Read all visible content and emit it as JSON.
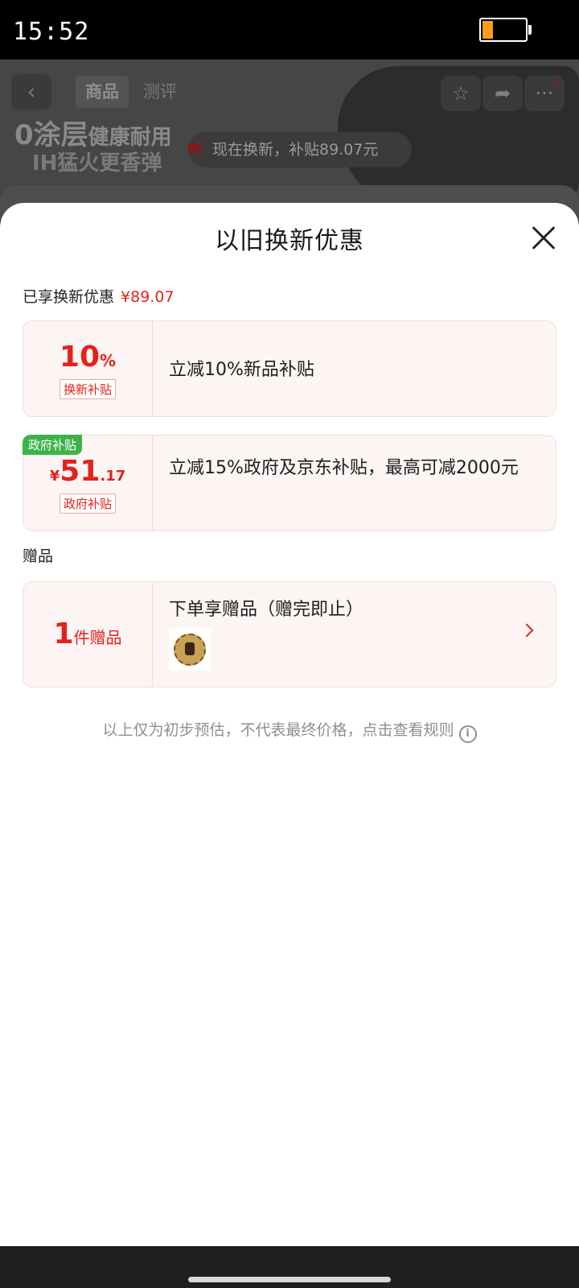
{
  "status_bar": {
    "time": "15:52",
    "battery_level": 0.25,
    "battery_color": "#ff9a1a"
  },
  "background_page": {
    "tabs": [
      "商品",
      "测评"
    ],
    "cart_badge": "2",
    "promo_line1_big": "0涂层",
    "promo_line1_small": "健康耐用",
    "promo_line2": "IH猛火更香弹",
    "banner_text": "现在换新，补贴89.07元",
    "icons": [
      "back-icon",
      "star-icon",
      "share-icon",
      "more-icon"
    ]
  },
  "sheet": {
    "title": "以旧换新优惠",
    "enjoyed_label": "已享换新优惠",
    "enjoyed_amount": "¥89.07",
    "offers": [
      {
        "value_main": "10",
        "value_unit": "%",
        "tag": "换新补贴",
        "description": "立减10%新品补贴"
      },
      {
        "corner_label": "政府补贴",
        "currency": "¥",
        "value_main": "51",
        "value_decimal": ".17",
        "tag": "政府补贴",
        "description": "立减15%政府及京东补贴，最高可减2000元"
      }
    ],
    "gift_heading": "赠品",
    "gift": {
      "count": "1",
      "count_unit": "件赠品",
      "description": "下单享赠品（赠完即止）"
    },
    "footnote": "以上仅为初步预估，不代表最终价格，点击查看规则",
    "accent_color": "#e2231a",
    "gov_label_color": "#3cb34a"
  }
}
